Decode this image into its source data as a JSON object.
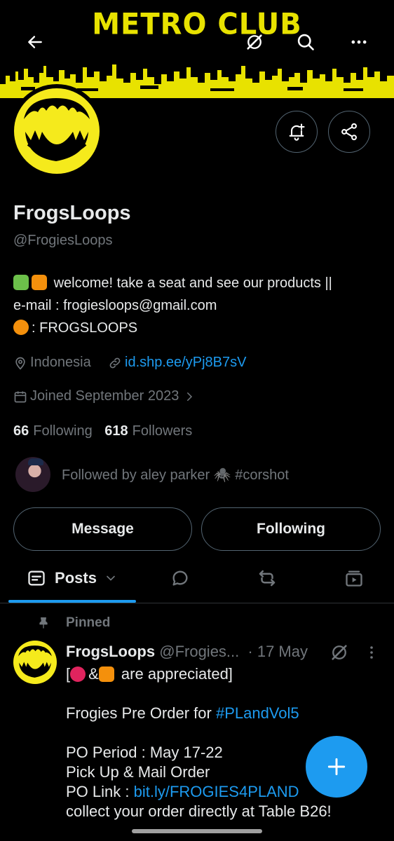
{
  "banner": {
    "title": "METRO CLUB"
  },
  "profile": {
    "name": "FrogsLoops",
    "handle": "@FrogiesLoops",
    "bio_line1": "welcome! take a seat and see our products ||",
    "bio_line2": "e-mail : frogiesloops@gmail.com",
    "bio_line3": ": FROGSLOOPS",
    "location": "Indonesia",
    "website": "id.shp.ee/yPj8B7sV",
    "joined": "Joined September 2023",
    "following_count": "66",
    "following_label": "Following",
    "followers_count": "618",
    "followers_label": "Followers",
    "followed_by": "Followed by aley parker 🕷️ #corshot"
  },
  "actions": {
    "message": "Message",
    "following": "Following"
  },
  "tabs": [
    {
      "label": "Posts",
      "icon": "posts-icon"
    },
    {
      "label": "",
      "icon": "replies-icon"
    },
    {
      "label": "",
      "icon": "reposts-icon"
    },
    {
      "label": "",
      "icon": "media-icon"
    }
  ],
  "post": {
    "pinned_label": "Pinned",
    "author_name": "FrogsLoops",
    "author_handle": "@Frogies...",
    "date": "· 17 May",
    "line1_prefix": "[",
    "line1_mid": "&",
    "line1_suffix": " are appreciated]",
    "line2_prefix": "Frogies Pre Order for ",
    "line2_hashtag": "#PLandVol5",
    "line3": "PO Period : May 17-22",
    "line4": "Pick Up & Mail Order",
    "line5_prefix": "PO Link : ",
    "line5_link": "bit.ly/FROGIES4PLAND",
    "line6": "collect your order directly at Table B26!"
  },
  "colors": {
    "accent": "#1d9bf0",
    "banner_yellow": "#e8e200",
    "background": "#000000",
    "muted": "#71767b"
  }
}
